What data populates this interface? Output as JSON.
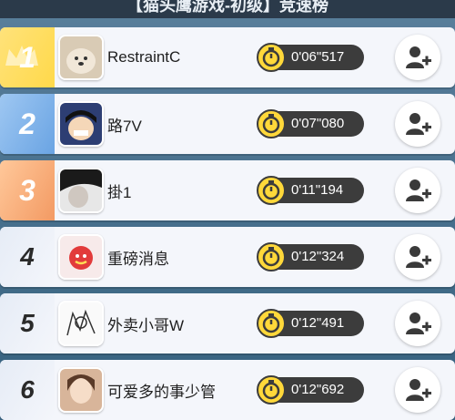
{
  "header": {
    "title": "【猫头鹰游戏-初级】竞速榜"
  },
  "leaderboard": [
    {
      "rank": "1",
      "name": "RestraintC",
      "time": "0'06\"517"
    },
    {
      "rank": "2",
      "name": "路7V",
      "time": "0'07\"080"
    },
    {
      "rank": "3",
      "name": "掛1",
      "time": "0'11\"194"
    },
    {
      "rank": "4",
      "name": "重磅消息",
      "time": "0'12\"324"
    },
    {
      "rank": "5",
      "name": "外卖小哥W",
      "time": "0'12\"491"
    },
    {
      "rank": "6",
      "name": "可爱多的事少管",
      "time": "0'12\"692"
    }
  ],
  "icons": {
    "timer": "stopwatch-icon",
    "add_friend": "add-friend-icon",
    "crown": "crown-icon"
  },
  "colors": {
    "gold": "#ffd94a",
    "silver_blue": "#6aa4e3",
    "bronze": "#f39a63",
    "timer_yellow": "#ffd83a",
    "timer_bg": "#3c3c3c"
  }
}
